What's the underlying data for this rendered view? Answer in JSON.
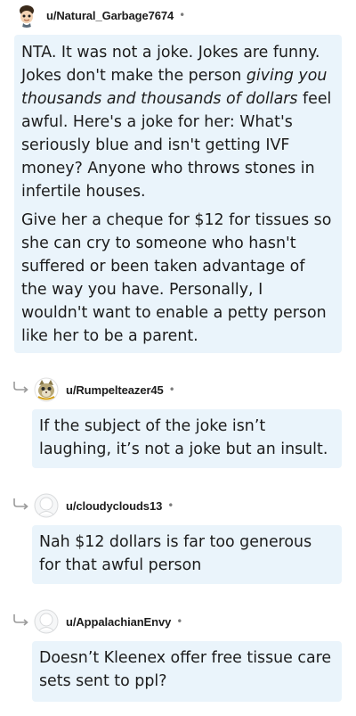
{
  "comments": [
    {
      "username": "u/Natural_Garbage7674",
      "dot": "•",
      "avatar_icon": "cartoon-avatar-icon",
      "paragraphs": [
        {
          "before": "NTA. It was not a joke. Jokes are funny. Jokes don't make the person ",
          "emphasis": "giving you thousands and thousands of dollars",
          "after": " feel awful. Here's a joke for her: What's seriously blue and isn't getting IVF money? Anyone who throws stones in infertile houses."
        },
        {
          "text": "Give her a cheque for $12 for tissues so she can cry to someone who hasn't suffered or been taken advantage of the way you have. Personally, I wouldn't want to enable a petty person like her to be a parent."
        }
      ]
    },
    {
      "username": "u/Rumpelteazer45",
      "dot": "•",
      "avatar_icon": "cat-avatar-icon",
      "text": "If the subject of the joke isn’t laughing, it’s not a joke but an insult."
    },
    {
      "username": "u/cloudyclouds13",
      "dot": "•",
      "avatar_icon": "default-avatar-icon",
      "text": "Nah $12 dollars is far too generous for that awful person"
    },
    {
      "username": "u/AppalachianEnvy",
      "dot": "•",
      "avatar_icon": "default-avatar-icon",
      "text": "Doesn’t Kleenex offer free tissue care sets sent to ppl?"
    }
  ],
  "colors": {
    "bubble": "#eaf4fb",
    "text": "#1c1c1c",
    "muted": "#7c7c7c"
  }
}
